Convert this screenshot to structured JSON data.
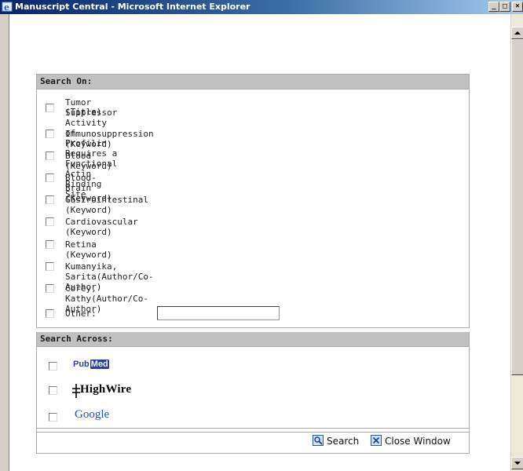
{
  "window": {
    "title": "Manuscript Central - Microsoft Internet Explorer",
    "minimize_glyph": "_",
    "restore_glyph": "□",
    "close_glyph": "×"
  },
  "search_on": {
    "header": "Search On:",
    "items": [
      {
        "label": "Tumor Suppressor Activity of Profilin Requires a Functional Actin Binding Site",
        "label_line2": "(Title)"
      },
      {
        "label": "Immunosuppression (Keyword)"
      },
      {
        "label": "Blood (Keyword)"
      },
      {
        "label": "Blood-Brain (Keyword)"
      },
      {
        "label": "Gastrointestinal (Keyword)"
      },
      {
        "label": "Cardiovascular (Keyword)"
      },
      {
        "label": "Retina (Keyword)"
      },
      {
        "label": "Kumanyika, Sarita(Author/Co-Author)"
      },
      {
        "label": "Corey, Kathy(Author/Co-Author)"
      }
    ],
    "other_label": "Other:",
    "other_value": ""
  },
  "search_across": {
    "header": "Search Across:",
    "pubmed_pub": "Pub",
    "pubmed_med": "Med",
    "highwire": "HighWire",
    "google": "Google"
  },
  "actions": {
    "search": "Search",
    "close": "Close Window"
  },
  "colors": {
    "panel_header_bg": "#c0c0c0",
    "titlebar_start": "#0a246a",
    "pubmed_blue": "#2b3f9a"
  }
}
